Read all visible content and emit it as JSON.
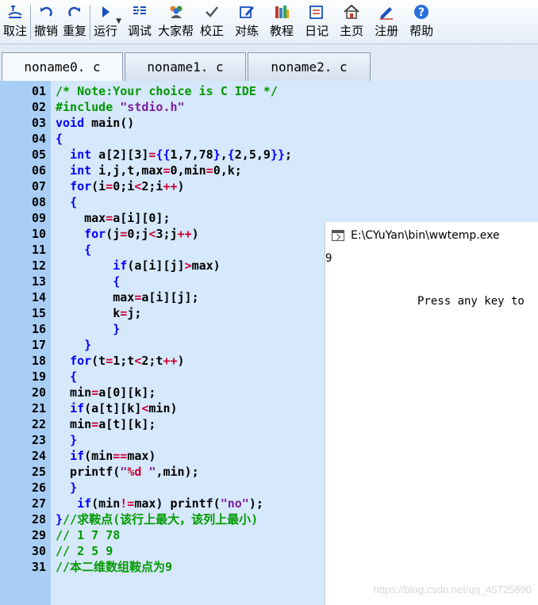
{
  "toolbar": {
    "items": [
      {
        "name": "undo-edit",
        "label": "取注"
      },
      {
        "name": "revoke",
        "label": "撤销"
      },
      {
        "name": "redo",
        "label": "重复"
      },
      {
        "name": "run",
        "label": "运行"
      },
      {
        "name": "debug",
        "label": "调试"
      },
      {
        "name": "help-community",
        "label": "大家帮"
      },
      {
        "name": "check",
        "label": "校正"
      },
      {
        "name": "practice",
        "label": "对练"
      },
      {
        "name": "tutorial",
        "label": "教程"
      },
      {
        "name": "diary",
        "label": "日记"
      },
      {
        "name": "home",
        "label": "主页"
      },
      {
        "name": "register",
        "label": "注册"
      },
      {
        "name": "help",
        "label": "帮助"
      }
    ]
  },
  "tabs": [
    "noname0. c",
    "noname1. c",
    "noname2. c"
  ],
  "editor": {
    "line_numbers": [
      "01",
      "02",
      "03",
      "04",
      "05",
      "06",
      "07",
      "08",
      "09",
      "10",
      "11",
      "12",
      "13",
      "14",
      "15",
      "16",
      "17",
      "18",
      "19",
      "20",
      "21",
      "22",
      "23",
      "24",
      "25",
      "26",
      "27",
      "28",
      "29",
      "30",
      "31"
    ]
  },
  "console": {
    "title": "E:\\CYuYan\\bin\\wwtemp.exe",
    "output": "9",
    "prompt": "Press any key to"
  },
  "watermark": "https://blog.csdn.net/qq_45725890"
}
